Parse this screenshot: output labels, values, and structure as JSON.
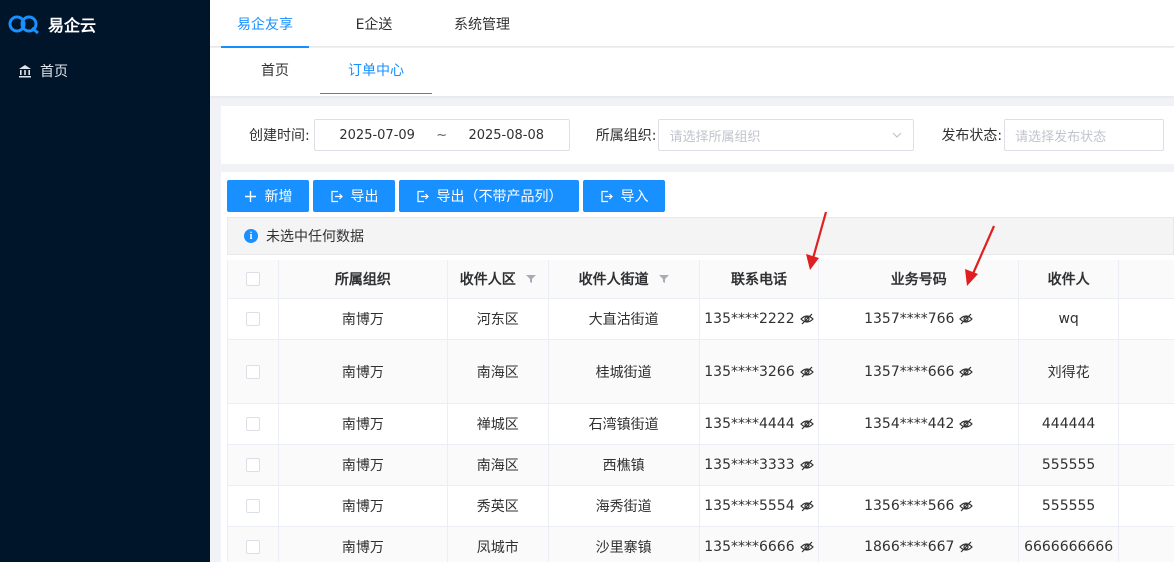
{
  "app": {
    "title": "易企云"
  },
  "sidebar": {
    "items": [
      {
        "label": "首页",
        "icon": "bank-icon"
      }
    ]
  },
  "topnav": {
    "tabs": [
      {
        "label": "易企友享",
        "active": true
      },
      {
        "label": "E企送",
        "active": false
      },
      {
        "label": "系统管理",
        "active": false
      }
    ]
  },
  "subnav": {
    "tabs": [
      {
        "label": "首页",
        "active": false
      },
      {
        "label": "订单中心",
        "active": true
      }
    ]
  },
  "filters": {
    "created_label": "创建时间:",
    "date_start": "2025-07-09",
    "date_sep": "~",
    "date_end": "2025-08-08",
    "org_label": "所属组织:",
    "org_placeholder": "请选择所属组织",
    "status_label": "发布状态:",
    "status_placeholder": "请选择发布状态"
  },
  "toolbar": {
    "add": "新增",
    "export": "导出",
    "export_no_product": "导出（不带产品列）",
    "import": "导入"
  },
  "alert": {
    "text": "未选中任何数据"
  },
  "table": {
    "headers": [
      "所属组织",
      "收件人区",
      "收件人街道",
      "联系电话",
      "业务号码",
      "收件人"
    ],
    "rows": [
      {
        "org": "南博万",
        "district": "河东区",
        "street": "大直沽街道",
        "phone": "135****2222",
        "biz": "1357****766",
        "recipient": "wq"
      },
      {
        "org": "南博万",
        "district": "南海区",
        "street": "桂城街道",
        "phone": "135****3266",
        "biz": "1357****666",
        "recipient": "刘得花"
      },
      {
        "org": "南博万",
        "district": "禅城区",
        "street": "石湾镇街道",
        "phone": "135****4444",
        "biz": "1354****442",
        "recipient": "444444"
      },
      {
        "org": "南博万",
        "district": "南海区",
        "street": "西樵镇",
        "phone": "135****3333",
        "biz": "",
        "recipient": "555555"
      },
      {
        "org": "南博万",
        "district": "秀英区",
        "street": "海秀街道",
        "phone": "135****5554",
        "biz": "1356****566",
        "recipient": "555555"
      },
      {
        "org": "南博万",
        "district": "凤城市",
        "street": "沙里寨镇",
        "phone": "135****6666",
        "biz": "1866****667",
        "recipient": "6666666666"
      }
    ]
  },
  "colors": {
    "primary": "#1890ff",
    "sidebar": "#001529",
    "annotation": "#e02020"
  }
}
